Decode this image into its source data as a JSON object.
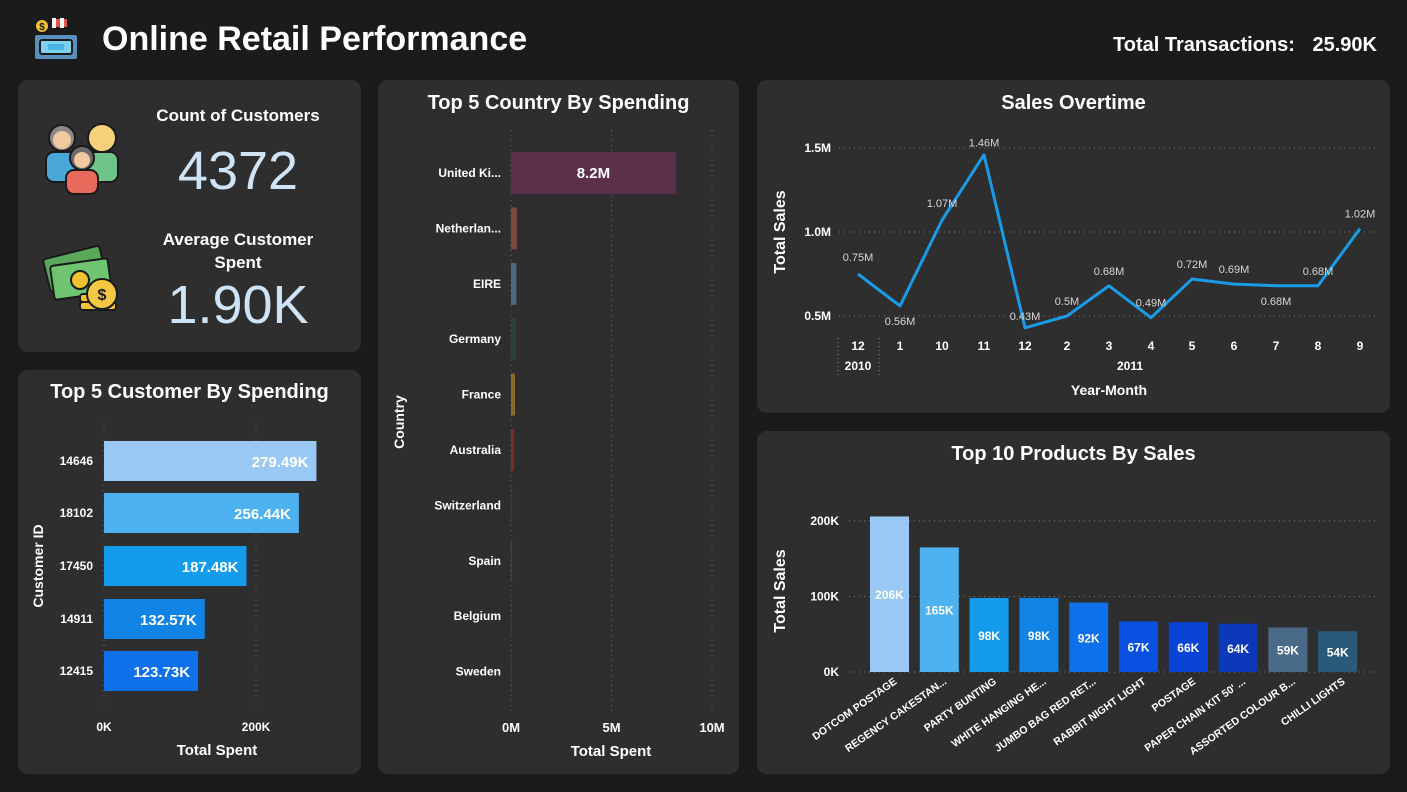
{
  "header": {
    "title": "Online Retail Performance",
    "total_transactions_label": "Total Transactions:",
    "total_transactions_value": "25.90K",
    "icon": "shop-icon"
  },
  "kpis": {
    "customers": {
      "label": "Count of Customers",
      "value": "4372",
      "icon": "customers-group-icon"
    },
    "avg_spent": {
      "label": "Average Customer Spent",
      "value": "1.90K",
      "icon": "money-coins-icon"
    }
  },
  "top_customers": {
    "title": "Top 5 Customer By Spending",
    "xlabel": "Total Spent",
    "ylabel": "Customer ID",
    "x_ticks": [
      "0K",
      "200K"
    ],
    "chart_data": {
      "type": "bar",
      "orientation": "horizontal",
      "categories": [
        "14646",
        "18102",
        "17450",
        "14911",
        "12415"
      ],
      "values": [
        279.49,
        256.44,
        187.48,
        132.57,
        123.73
      ],
      "value_unit": "K",
      "data_labels": [
        "279.49K",
        "256.44K",
        "187.48K",
        "132.57K",
        "123.73K"
      ],
      "colors": [
        "#99c8f5",
        "#4db2ef",
        "#159bec",
        "#1083e5",
        "#0e70ea"
      ],
      "xlim": [
        0,
        300
      ]
    }
  },
  "top_countries": {
    "title": "Top 5 Country By Spending",
    "xlabel": "Total Spent",
    "ylabel": "Country",
    "x_ticks": [
      "0M",
      "5M",
      "10M"
    ],
    "chart_data": {
      "type": "bar",
      "orientation": "horizontal",
      "categories": [
        "United Ki...",
        "Netherlan...",
        "EIRE",
        "Germany",
        "France",
        "Australia",
        "Switzerland",
        "Spain",
        "Belgium",
        "Sweden"
      ],
      "values": [
        8.2,
        0.29,
        0.27,
        0.23,
        0.2,
        0.14,
        0.06,
        0.06,
        0.04,
        0.04
      ],
      "value_unit": "M",
      "data_labels": [
        "8.2M",
        "",
        "",
        "",
        "",
        "",
        "",
        "",
        "",
        ""
      ],
      "colors": [
        "#5c2f4a",
        "#7a4a3e",
        "#4a6a7a",
        "#2e3e3a",
        "#8a6a2a",
        "#7a2e2e",
        "#3a3a3a",
        "#2e4a4a",
        "#3a3a3a",
        "#3a3a3a"
      ],
      "xlim": [
        0,
        10
      ]
    }
  },
  "sales_overtime": {
    "title": "Sales Overtime",
    "xlabel": "Year-Month",
    "ylabel": "Total Sales",
    "y_ticks": [
      "1.5M",
      "1.0M",
      "0.5M"
    ],
    "chart_data": {
      "type": "line",
      "x": [
        "12",
        "1",
        "10",
        "11",
        "12",
        "2",
        "3",
        "4",
        "5",
        "6",
        "7",
        "8",
        "9"
      ],
      "years": [
        {
          "label": "2010",
          "span": [
            0,
            0
          ]
        },
        {
          "label": "2011",
          "span": [
            1,
            12
          ]
        }
      ],
      "values": [
        0.75,
        0.56,
        1.07,
        1.46,
        0.43,
        0.5,
        0.68,
        0.49,
        0.72,
        0.69,
        0.68,
        0.68,
        1.02
      ],
      "data_labels": [
        "0.75M",
        "0.56M",
        "1.07M",
        "1.46M",
        "0.43M",
        "0.5M",
        "0.68M",
        "0.49M",
        "0.72M",
        "0.69M",
        "0.68M",
        "0.68M",
        "1.02M"
      ],
      "ylim": [
        0.4,
        1.55
      ],
      "color": "#1a9be6"
    }
  },
  "top_products": {
    "title": "Top 10 Products By Sales",
    "ylabel": "Total Sales",
    "y_ticks": [
      "200K",
      "100K",
      "0K"
    ],
    "chart_data": {
      "type": "bar",
      "categories": [
        "DOTCOM POSTAGE",
        "REGENCY CAKESTAN...",
        "PARTY BUNTING",
        "WHITE HANGING HE...",
        "JUMBO BAG RED RET...",
        "RABBIT NIGHT LIGHT",
        "POSTAGE",
        "PAPER CHAIN KIT 50' ...",
        "ASSORTED COLOUR B...",
        "CHILLI LIGHTS"
      ],
      "values": [
        206,
        165,
        98,
        98,
        92,
        67,
        66,
        64,
        59,
        54
      ],
      "value_unit": "K",
      "data_labels": [
        "206K",
        "165K",
        "98K",
        "98K",
        "92K",
        "67K",
        "66K",
        "64K",
        "59K",
        "54K"
      ],
      "colors": [
        "#99c8f5",
        "#4db2ef",
        "#159bec",
        "#1083e5",
        "#0e70ea",
        "#0a50e0",
        "#0a44d6",
        "#0a38b8",
        "#4a6a8a",
        "#2a5a7a"
      ],
      "ylim": [
        0,
        210
      ]
    }
  }
}
